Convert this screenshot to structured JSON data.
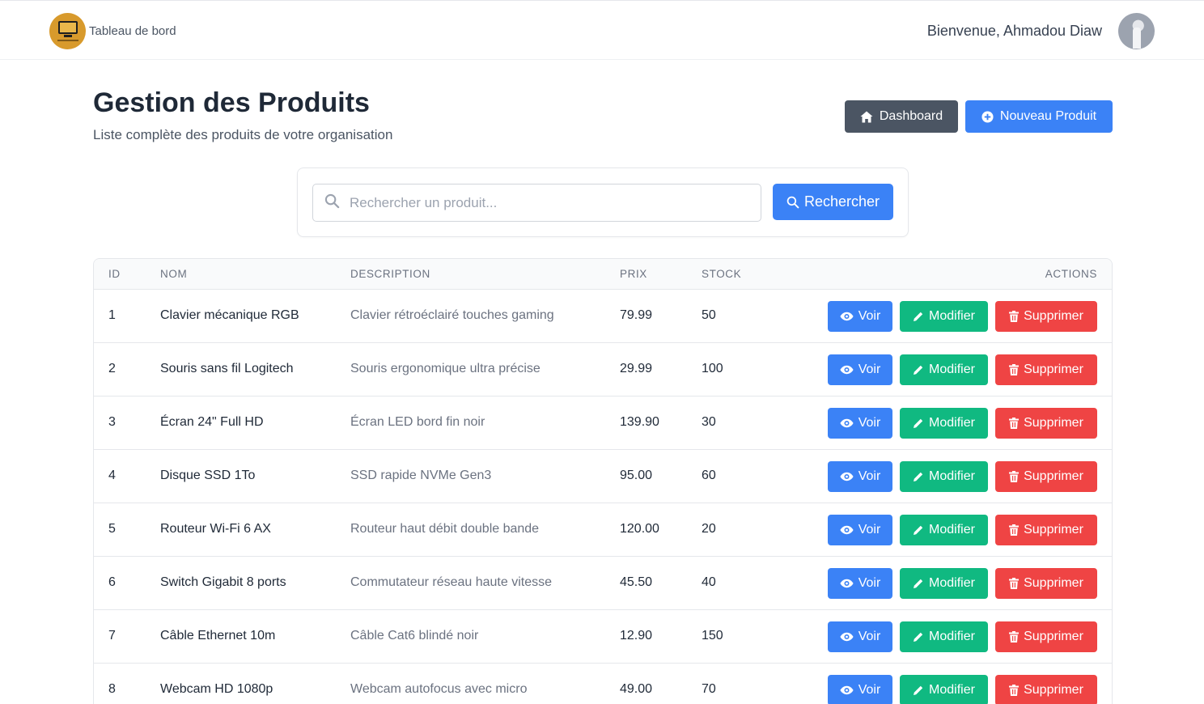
{
  "header": {
    "brand_label": "Tableau de bord",
    "welcome_text": "Bienvenue, Ahmadou Diaw"
  },
  "page": {
    "title": "Gestion des Produits",
    "subtitle": "Liste complète des produits de votre organisation",
    "dashboard_button": "Dashboard",
    "new_product_button": "Nouveau Produit"
  },
  "search": {
    "placeholder": "Rechercher un produit...",
    "value": "",
    "button_label": "Rechercher"
  },
  "table": {
    "columns": [
      "ID",
      "NOM",
      "DESCRIPTION",
      "PRIX",
      "STOCK",
      "ACTIONS"
    ],
    "action_labels": {
      "view": "Voir",
      "edit": "Modifier",
      "delete": "Supprimer"
    },
    "rows": [
      {
        "id": "1",
        "nom": "Clavier mécanique RGB",
        "description": "Clavier rétroéclairé touches gaming",
        "prix": "79.99",
        "stock": "50"
      },
      {
        "id": "2",
        "nom": "Souris sans fil Logitech",
        "description": "Souris ergonomique ultra précise",
        "prix": "29.99",
        "stock": "100"
      },
      {
        "id": "3",
        "nom": "Écran 24\" Full HD",
        "description": "Écran LED bord fin noir",
        "prix": "139.90",
        "stock": "30"
      },
      {
        "id": "4",
        "nom": "Disque SSD 1To",
        "description": "SSD rapide NVMe Gen3",
        "prix": "95.00",
        "stock": "60"
      },
      {
        "id": "5",
        "nom": "Routeur Wi-Fi 6 AX",
        "description": "Routeur haut débit double bande",
        "prix": "120.00",
        "stock": "20"
      },
      {
        "id": "6",
        "nom": "Switch Gigabit 8 ports",
        "description": "Commutateur réseau haute vitesse",
        "prix": "45.50",
        "stock": "40"
      },
      {
        "id": "7",
        "nom": "Câble Ethernet 10m",
        "description": "Câble Cat6 blindé noir",
        "prix": "12.90",
        "stock": "150"
      },
      {
        "id": "8",
        "nom": "Webcam HD 1080p",
        "description": "Webcam autofocus avec micro",
        "prix": "49.00",
        "stock": "70"
      }
    ]
  },
  "colors": {
    "primary": "#3b82f6",
    "success": "#10b981",
    "danger": "#ef4444",
    "secondary": "#4b5563"
  },
  "icons": {
    "brand": "monitor-logo-icon",
    "dashboard": "home-icon",
    "new": "plus-circle-icon",
    "search": "search-icon",
    "view": "eye-icon",
    "edit": "pencil-icon",
    "delete": "trash-icon"
  }
}
